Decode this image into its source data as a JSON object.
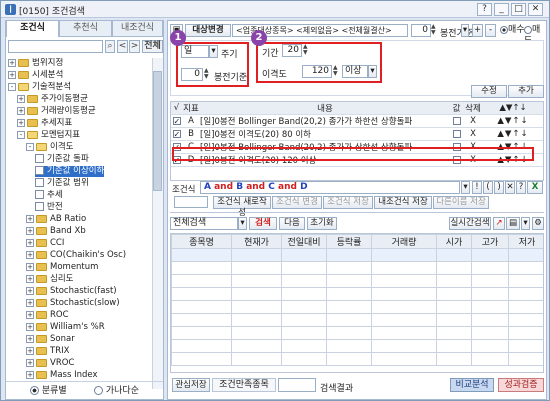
{
  "window": {
    "code": "[0150]",
    "title": "조건검색"
  },
  "left": {
    "tabs": [
      "조건식",
      "추천식",
      "내조건식"
    ],
    "all_button": "전체",
    "tree": [
      {
        "label": "범위지정",
        "exp": "+"
      },
      {
        "label": "시세분석",
        "exp": "+"
      },
      {
        "label": "기술적분석",
        "exp": "-"
      },
      {
        "label": "주가이동평균",
        "exp": "+"
      },
      {
        "label": "거래량이동평균",
        "exp": "+"
      },
      {
        "label": "추세지표",
        "exp": "+"
      },
      {
        "label": "모멘텀지표",
        "exp": "-"
      },
      {
        "label": "이격도",
        "exp": "-"
      },
      {
        "label": "기준값 돌파",
        "exp": ""
      },
      {
        "label": "기준값 이상이하",
        "exp": ""
      },
      {
        "label": "기준값 범위",
        "exp": ""
      },
      {
        "label": "추세",
        "exp": ""
      },
      {
        "label": "반전",
        "exp": ""
      },
      {
        "label": "AB Ratio",
        "exp": "+"
      },
      {
        "label": "Band Xb",
        "exp": "+"
      },
      {
        "label": "CCI",
        "exp": "+"
      },
      {
        "label": "CO(Chaikin's Osc)",
        "exp": "+"
      },
      {
        "label": "Momentum",
        "exp": "+"
      },
      {
        "label": "심리도",
        "exp": "+"
      },
      {
        "label": "Stochastic(fast)",
        "exp": "+"
      },
      {
        "label": "Stochastic(slow)",
        "exp": "+"
      },
      {
        "label": "ROC",
        "exp": "+"
      },
      {
        "label": "William's %R",
        "exp": "+"
      },
      {
        "label": "Sonar",
        "exp": "+"
      },
      {
        "label": "TRIX",
        "exp": "+"
      },
      {
        "label": "VROC",
        "exp": "+"
      },
      {
        "label": "Mass Index",
        "exp": "+"
      }
    ],
    "radio1": "분류별",
    "radio2": "가나다순"
  },
  "header": {
    "target": "대상변경",
    "target_desc": "<업종대상종목> <제외없음> <전체월결산>",
    "bong_value": "0",
    "bong_label": "봉전기준",
    "plus": "+",
    "minus": "-",
    "buy": "매수",
    "sell": "매도"
  },
  "params": {
    "period_unit": "일",
    "period_label": "주기",
    "bong_value": "0",
    "bong_label": "봉전기준",
    "term_label": "기간",
    "term_value": "20",
    "gap_label": "이격도",
    "gap_value": "120",
    "cmp": "이상",
    "badge1": "1",
    "badge2": "2"
  },
  "actions": {
    "edit": "수정",
    "add": "추가"
  },
  "cond_table": {
    "headers": [
      "√",
      "지표",
      "내용",
      "값",
      "삭제",
      "▲▼↑↓"
    ],
    "rows": [
      {
        "id": "A",
        "text": "[일]0봉전 Bollinger Band(20,2) 종가가 하한선 상향돌파",
        "x": "X"
      },
      {
        "id": "B",
        "text": "[일]0봉전 이격도(20) 80 이하",
        "x": "X"
      },
      {
        "id": "C",
        "text": "[일]0봉전 Bollinger Band(20,2) 종가가 상한선 상향돌파",
        "x": "X"
      },
      {
        "id": "D",
        "text": "[일]0봉전 이격도(20) 120 이상",
        "x": "X"
      }
    ]
  },
  "formula": {
    "label": "조건식",
    "tokens": [
      "A",
      "and",
      "B",
      "and",
      "C",
      "and",
      "D"
    ],
    "symbols": [
      "!",
      "(",
      ")",
      "",
      ""
    ]
  },
  "buttons": {
    "new": "조건식 새로작성",
    "change": "조건식 변경",
    "save": "조건식 저장",
    "my_save": "내조건식 저장",
    "other_save": "다른이름 저장"
  },
  "search": {
    "scope": "전체검색",
    "search": "검색",
    "next": "다음",
    "reset": "초기화",
    "realtime": "실시간검색"
  },
  "results": {
    "headers": [
      "종목명",
      "현재가",
      "전일대비",
      "등락률",
      "거래량",
      "시가",
      "고가",
      "저가"
    ]
  },
  "bottom": {
    "interest_save": "관심저장",
    "match_label": "조건만족종목",
    "result_label": "검색결과",
    "compare": "비교분석",
    "verify": "성과검증"
  },
  "colors": {
    "accent": "#2f6fc8",
    "red": "#e02020",
    "badge": "#8a43a8"
  }
}
